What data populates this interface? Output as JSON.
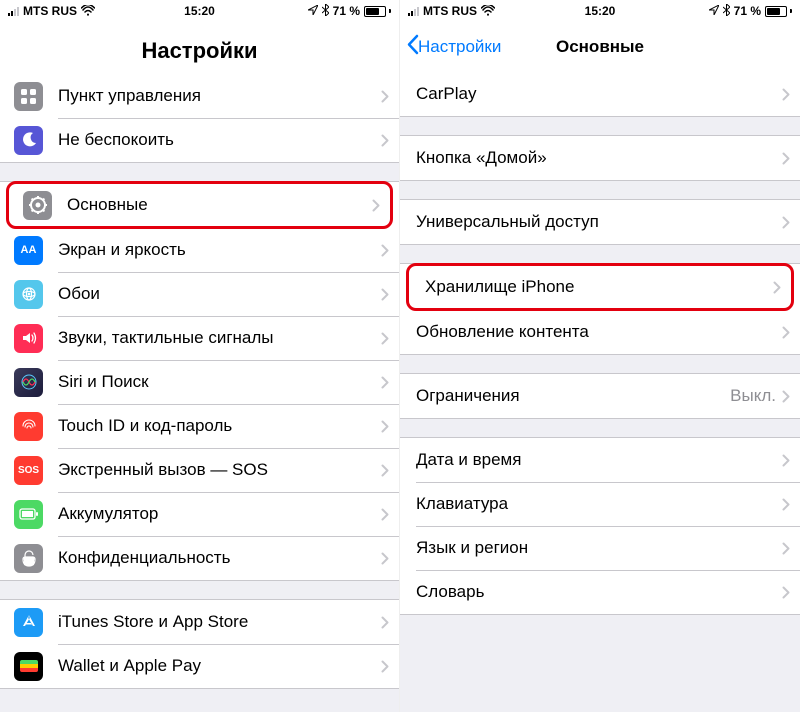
{
  "status": {
    "carrier": "MTS RUS",
    "time": "15:20",
    "battery_pct": "71 %",
    "bt_glyph": "✻",
    "loc_glyph": "➤"
  },
  "left": {
    "title": "Настройки",
    "groups": [
      [
        {
          "icon": "control",
          "label": "Пункт управления"
        },
        {
          "icon": "dnd",
          "label": "Не беспокоить"
        }
      ],
      [
        {
          "icon": "general",
          "label": "Основные",
          "highlight": true
        },
        {
          "icon": "display",
          "label": "Экран и яркость"
        },
        {
          "icon": "wallpaper",
          "label": "Обои"
        },
        {
          "icon": "sounds",
          "label": "Звуки, тактильные сигналы"
        },
        {
          "icon": "siri",
          "label": "Siri и Поиск"
        },
        {
          "icon": "touchid",
          "label": "Touch ID и код-пароль"
        },
        {
          "icon": "sos",
          "label": "Экстренный вызов — SOS"
        },
        {
          "icon": "battery",
          "label": "Аккумулятор"
        },
        {
          "icon": "privacy",
          "label": "Конфиденциальность"
        }
      ],
      [
        {
          "icon": "appstore",
          "label": "iTunes Store и App Store"
        },
        {
          "icon": "wallet",
          "label": "Wallet и Apple Pay"
        }
      ]
    ]
  },
  "right": {
    "back": "Настройки",
    "title": "Основные",
    "groups": [
      [
        {
          "label": "CarPlay"
        }
      ],
      [
        {
          "label": "Кнопка «Домой»"
        }
      ],
      [
        {
          "label": "Универсальный доступ"
        }
      ],
      [
        {
          "label": "Хранилище iPhone",
          "highlight": true
        },
        {
          "label": "Обновление контента"
        }
      ],
      [
        {
          "label": "Ограничения",
          "value": "Выкл."
        }
      ],
      [
        {
          "label": "Дата и время"
        },
        {
          "label": "Клавиатура"
        },
        {
          "label": "Язык и регион"
        },
        {
          "label": "Словарь"
        }
      ]
    ]
  }
}
